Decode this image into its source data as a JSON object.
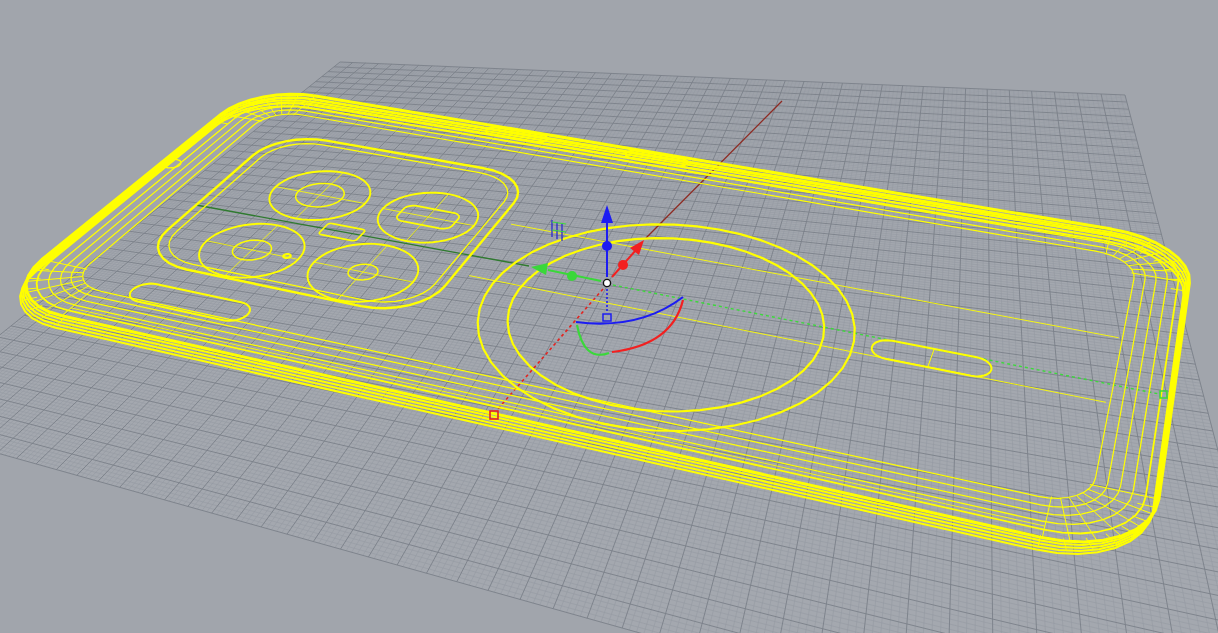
{
  "viewport": {
    "grid": {
      "visible": true
    },
    "world_axes": {
      "visible": true
    }
  },
  "model": {
    "selected": true
  },
  "gumball": {
    "visible": true
  }
}
